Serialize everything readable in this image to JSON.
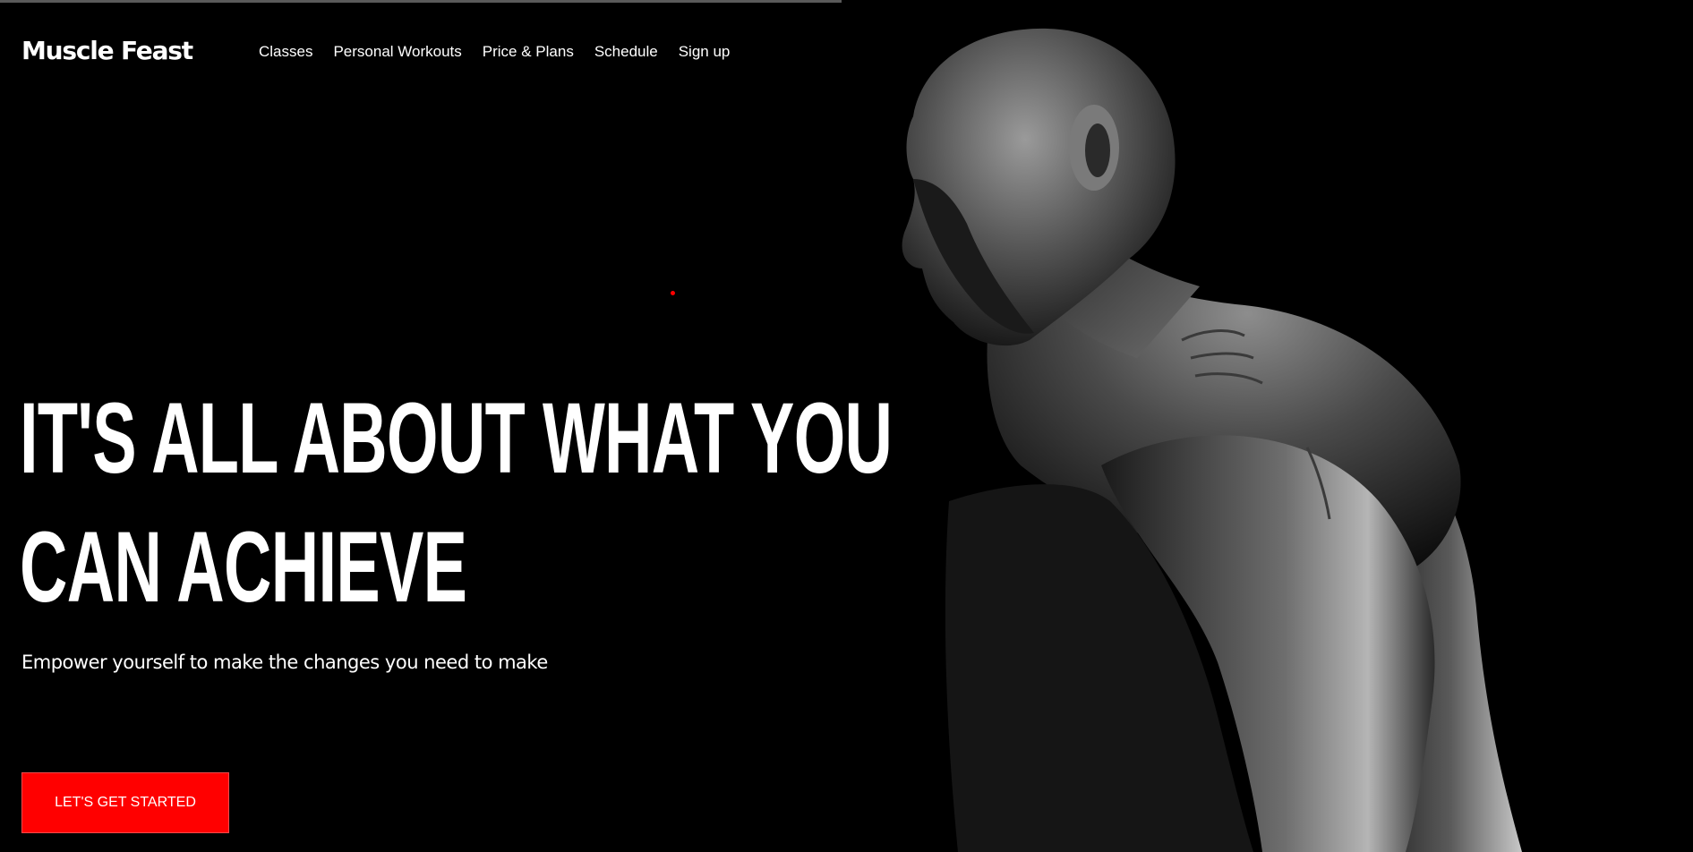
{
  "brand": {
    "name": "Muscle Feast"
  },
  "nav": {
    "items": [
      {
        "label": "Classes"
      },
      {
        "label": "Personal Workouts"
      },
      {
        "label": "Price & Plans"
      },
      {
        "label": "Schedule"
      },
      {
        "label": "Sign up"
      }
    ]
  },
  "hero": {
    "title_line1": "IT'S ALL ABOUT WHAT YOU",
    "title_line2": "CAN ACHIEVE",
    "subtitle": "Empower yourself to make the changes you need to make",
    "cta_label": "LET'S GET STARTED",
    "image_subject": "black-and-white photo of a muscular man looking down"
  },
  "colors": {
    "background": "#000000",
    "text": "#ffffff",
    "accent": "#ff0000"
  }
}
